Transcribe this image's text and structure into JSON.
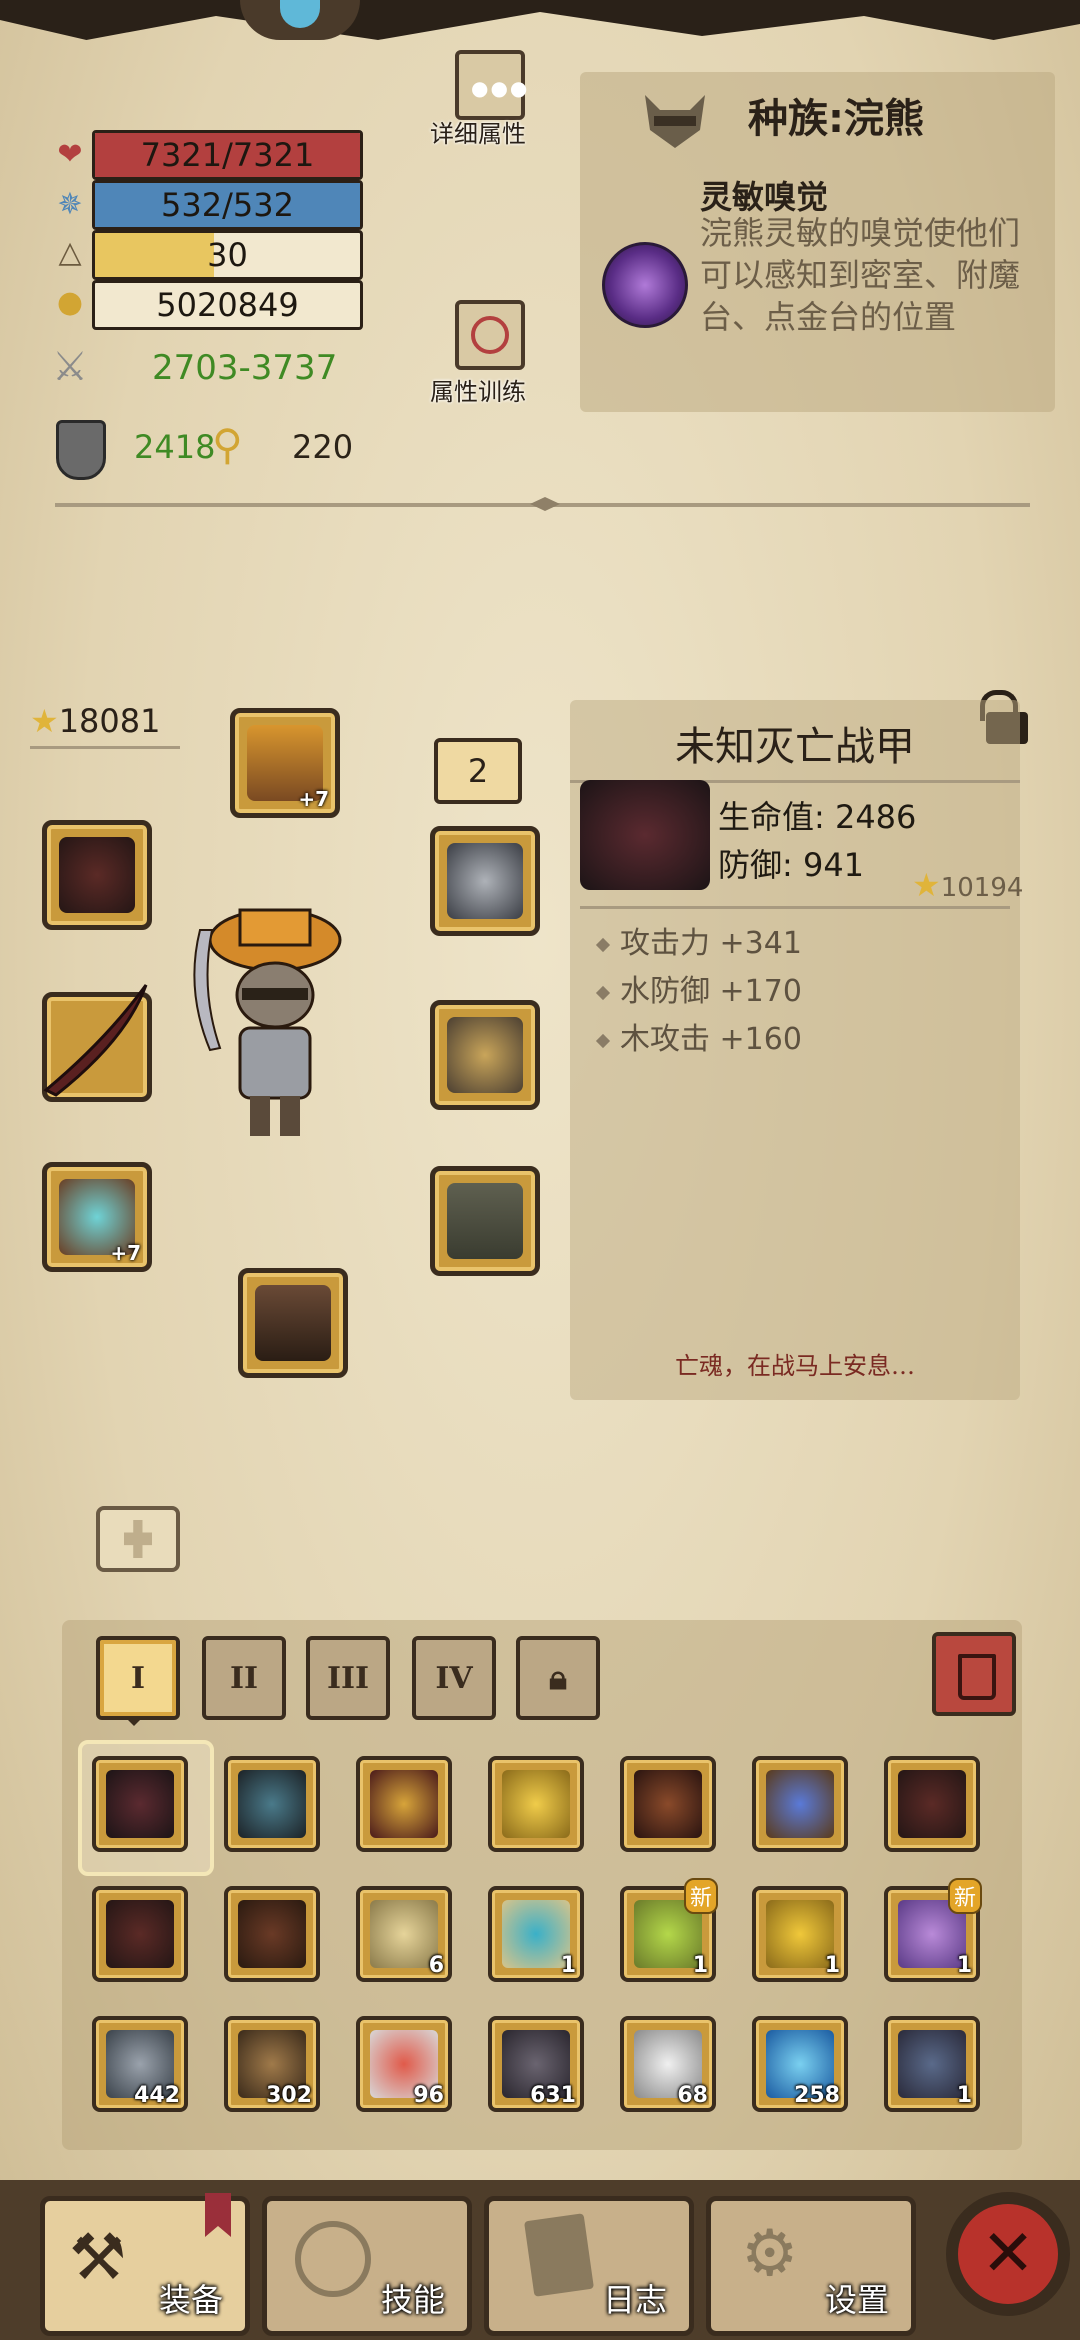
{
  "stats": {
    "hp": "7321/7321",
    "hp_ratio": 1.0,
    "mp": "532/532",
    "mp_ratio": 1.0,
    "level": "30",
    "level_ratio": 0.45,
    "gold": "5020849",
    "attack": "2703-3737",
    "defense": "2418",
    "strength": "220"
  },
  "buttons": {
    "detail_attr": "详细属性",
    "attr_training": "属性训练"
  },
  "race": {
    "title": "种族:浣熊",
    "skill_name": "灵敏嗅觉",
    "skill_desc": "浣熊灵敏的嗅觉使他们可以感知到密室、附魔台、点金台的位置"
  },
  "equipment": {
    "power": "18081",
    "helmet_plus": "+7",
    "ring_plus": "+7",
    "slot_count": "2"
  },
  "item": {
    "name": "未知灭亡战甲",
    "hp": "生命值: 2486",
    "defense": "防御: 941",
    "score": "10194",
    "bonuses": [
      "攻击力 +341",
      "水防御 +170",
      "木攻击 +160"
    ],
    "flavor": "亡魂，在战马上安息…"
  },
  "bag": {
    "tabs": [
      "I",
      "II",
      "III",
      "IV"
    ],
    "counts": {
      "scroll": "6",
      "eye_scroll": "1",
      "potion_green": "1",
      "potion_yellow": "1",
      "potion_purple": "1",
      "iron": "442",
      "chest": "302",
      "bowl": "96",
      "ingot": "631",
      "crystal": "68",
      "gem": "258",
      "eel": "1"
    },
    "new_label": "新"
  },
  "nav": {
    "equip": "装备",
    "skills": "技能",
    "log": "日志",
    "settings": "设置"
  },
  "colors": {
    "hp": "#b3403f",
    "mp": "#4f86b8",
    "level": "#e8c660",
    "attack_green": "#3f8a24"
  }
}
